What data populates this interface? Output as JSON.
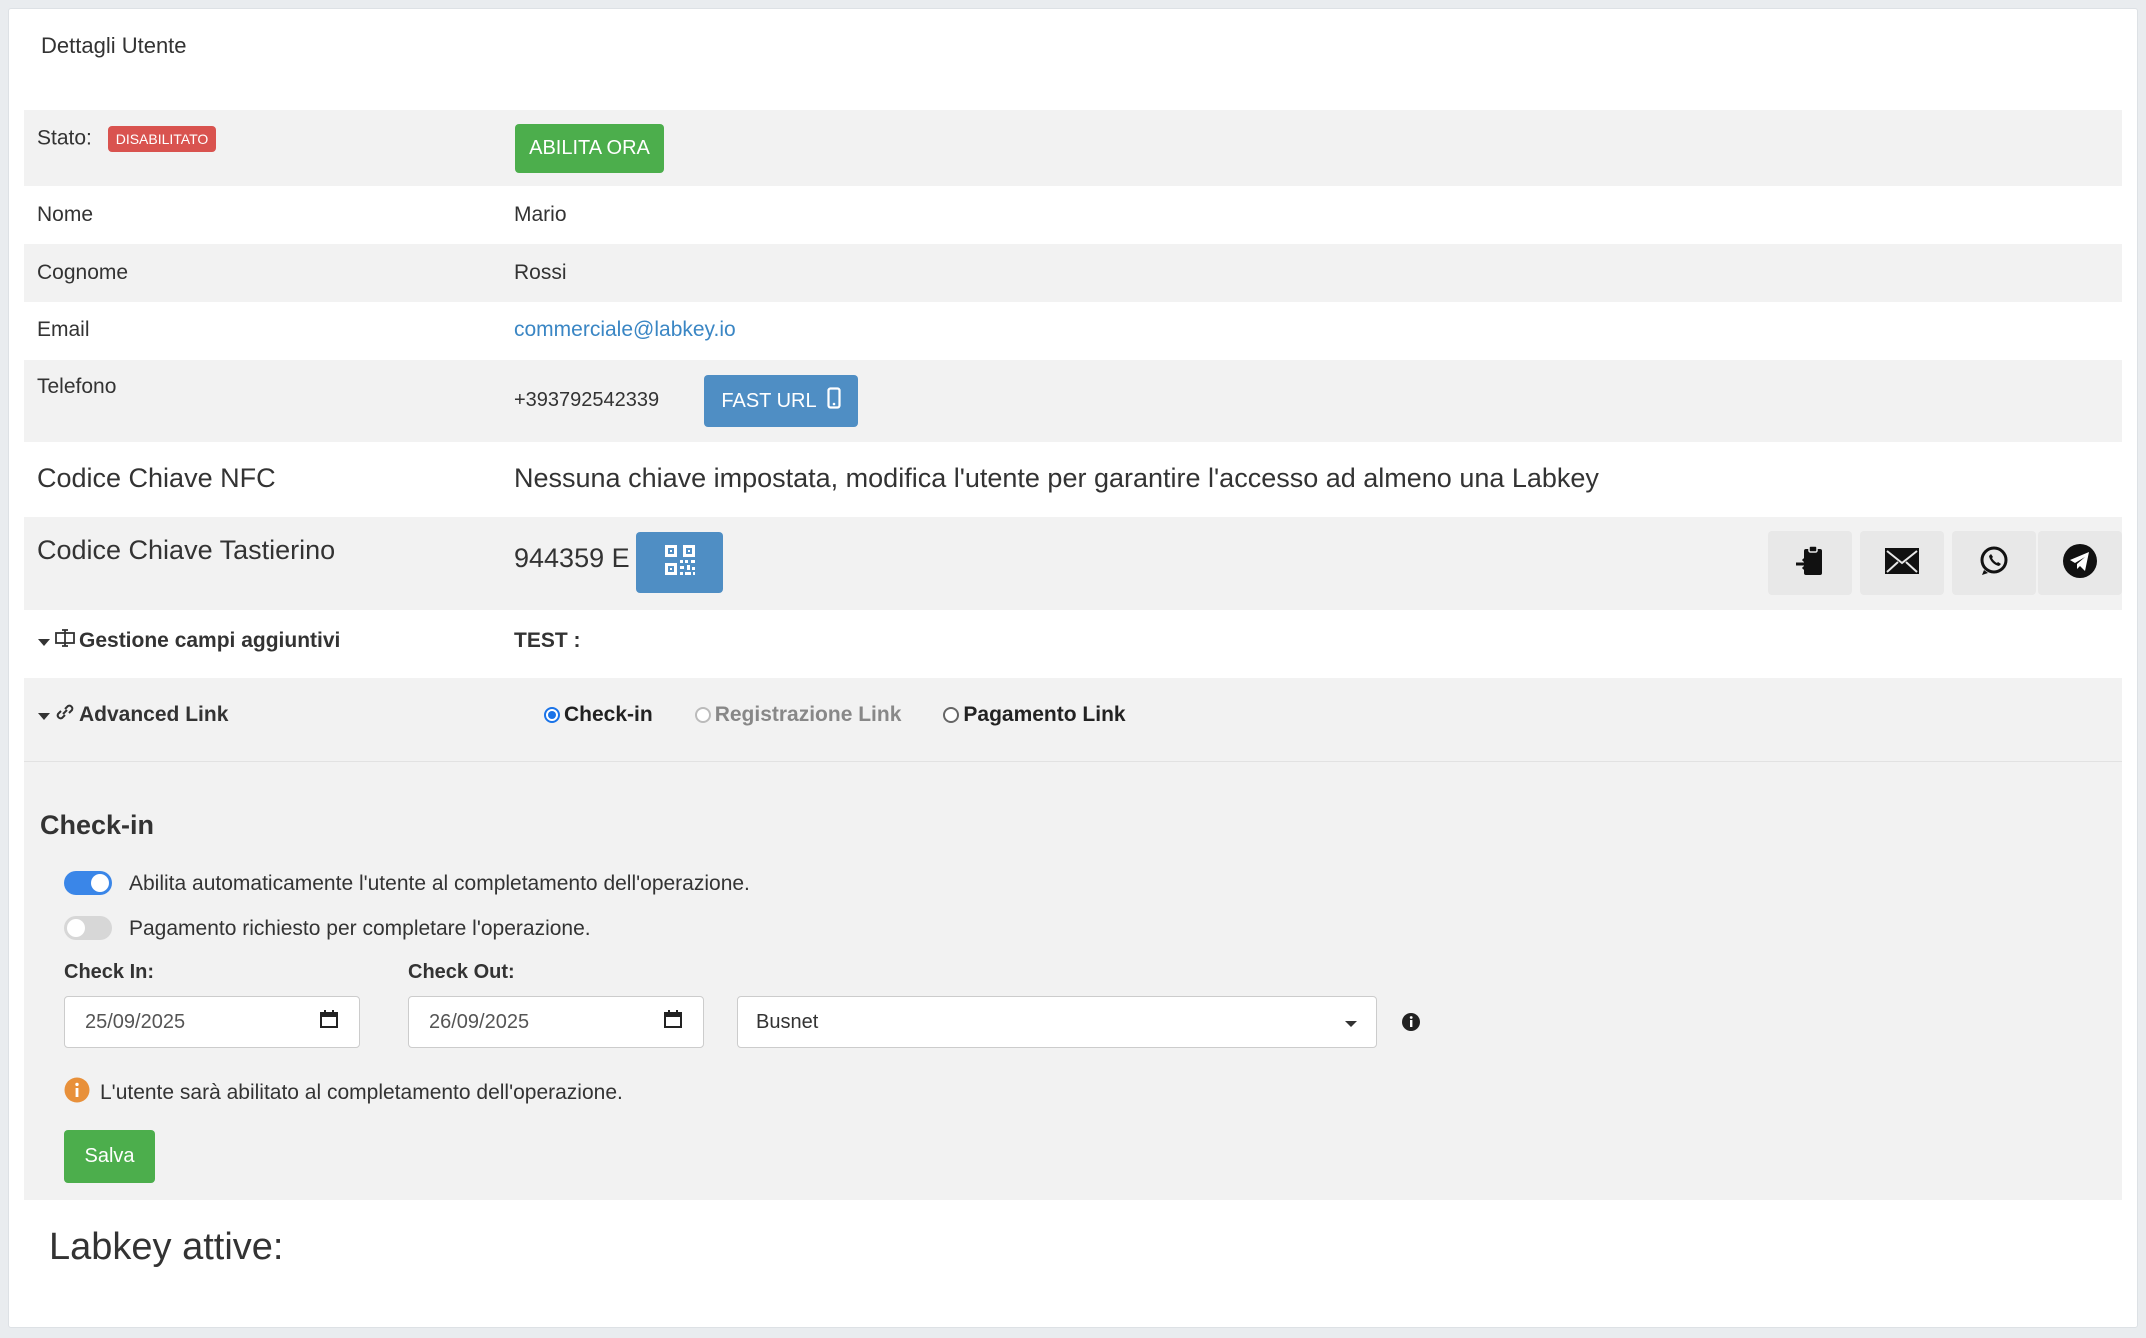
{
  "panel": {
    "title": "Dettagli Utente"
  },
  "status": {
    "label": "Stato:",
    "badge": "DISABILITATO",
    "enable_button": "ABILITA ORA"
  },
  "rows": {
    "nome": {
      "label": "Nome",
      "value": "Mario"
    },
    "cognome": {
      "label": "Cognome",
      "value": "Rossi"
    },
    "email": {
      "label": "Email",
      "value": "commerciale@labkey.io"
    },
    "telefono": {
      "label": "Telefono",
      "value": "+393792542339",
      "button": "FAST URL"
    },
    "nfc": {
      "label": "Codice Chiave NFC",
      "value": "Nessuna chiave impostata, modifica l'utente per garantire l'accesso ad almeno una Labkey"
    },
    "tastierino": {
      "label": "Codice Chiave Tastierino",
      "value": "944359 E"
    },
    "campi": {
      "label": "Gestione campi aggiuntivi",
      "value": "TEST :"
    },
    "advanced": {
      "label": "Advanced Link"
    }
  },
  "radios": [
    {
      "label": "Check-in",
      "state": "checked"
    },
    {
      "label": "Registrazione Link",
      "state": "disabled"
    },
    {
      "label": "Pagamento Link",
      "state": "unchecked"
    }
  ],
  "checkin": {
    "title": "Check-in",
    "toggle1": {
      "label": "Abilita automaticamente l'utente al completamento dell'operazione.",
      "on": true
    },
    "toggle2": {
      "label": "Pagamento richiesto per completare l'operazione.",
      "on": false
    },
    "checkin_label": "Check In:",
    "checkin_value": "25/09/2025",
    "checkout_label": "Check Out:",
    "checkout_value": "26/09/2025",
    "select_value": "Busnet",
    "note": "L'utente sarà abilitato al completamento dell'operazione.",
    "save_button": "Salva"
  },
  "footer": {
    "title": "Labkey attive:"
  },
  "colors": {
    "green": "#4cae4c",
    "blue": "#4f8ec4",
    "red": "#d9534f",
    "toggle_on": "#3a86e8",
    "info_orange": "#e8903a"
  }
}
